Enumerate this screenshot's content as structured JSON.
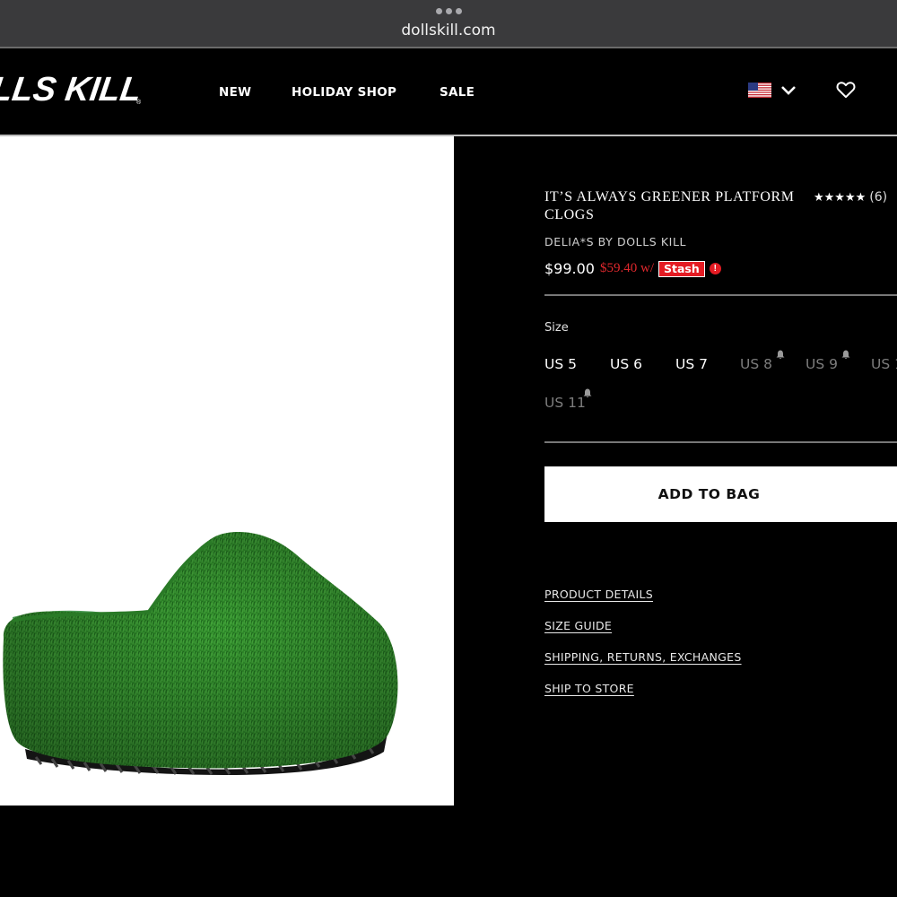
{
  "browser": {
    "url": "dollskill.com",
    "menu_icon": "more-dots-icon"
  },
  "header": {
    "logo_text": "LLS KILL",
    "nav": [
      "NEW",
      "HOLIDAY SHOP",
      "SALE"
    ],
    "region_icon": "us-flag-icon",
    "region_dropdown_icon": "chevron-down-icon",
    "wishlist_icon": "heart-icon"
  },
  "product": {
    "title": "IT’S ALWAYS GREENER PLATFORM CLOGS",
    "rating": 4.5,
    "rating_stars": "★★★★★",
    "review_count": "(6)",
    "brand": "DELIA*S BY DOLLS KILL",
    "price": "$99.00",
    "stash_price": "$59.40 w/",
    "stash_label": "Stash",
    "stash_info_icon": "info-icon",
    "image_alt": "green artificial turf platform clog"
  },
  "sizes": {
    "label": "Size",
    "options": [
      {
        "label": "US 5",
        "available": true
      },
      {
        "label": "US 6",
        "available": true
      },
      {
        "label": "US 7",
        "available": true
      },
      {
        "label": "US 8",
        "available": false
      },
      {
        "label": "US 9",
        "available": false
      },
      {
        "label": "US 1",
        "available": false
      },
      {
        "label": "US 11",
        "available": false
      }
    ]
  },
  "actions": {
    "add_to_bag": "ADD TO BAG"
  },
  "links": [
    "PRODUCT DETAILS",
    "SIZE GUIDE",
    "SHIPPING, RETURNS, EXCHANGES",
    "SHIP TO STORE"
  ],
  "colors": {
    "background": "#000000",
    "stash_red": "#e41b23",
    "turf_green": "#2f8a2a",
    "unavailable_text": "#7d7d7d"
  }
}
